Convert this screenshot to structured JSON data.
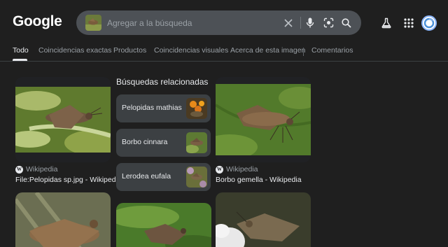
{
  "header": {
    "logo_text": "Google",
    "search_placeholder": "Agregar a la búsqueda",
    "icons": [
      "close-icon",
      "microphone-icon",
      "lens-icon",
      "search-icon",
      "labs-flask-icon",
      "apps-grid-icon",
      "avatar"
    ]
  },
  "tabs": [
    {
      "label": "Todo",
      "active": true
    },
    {
      "label": "Coincidencias exactas"
    },
    {
      "label": "Productos"
    },
    {
      "label": "Coincidencias visuales"
    },
    {
      "label": "Acerca de esta imagen"
    },
    {
      "label": "Comentarios"
    }
  ],
  "results": [
    {
      "source": "Wikipedia",
      "caption": "File:Pelopidas sp.jpg - Wikipedia"
    },
    {
      "source": "Wikipedia",
      "caption": "Borbo gemella - Wikipedia"
    }
  ],
  "related": {
    "title": "Búsquedas relacionadas",
    "items": [
      {
        "label": "Pelopidas mathias"
      },
      {
        "label": "Borbo cinnara"
      },
      {
        "label": "Lerodea eufala"
      }
    ]
  },
  "colors": {
    "background": "#1f1f1f",
    "search_bar": "#4d5156",
    "chip": "#3c4043",
    "text": "#e8eaed",
    "muted": "#9aa0a6"
  }
}
